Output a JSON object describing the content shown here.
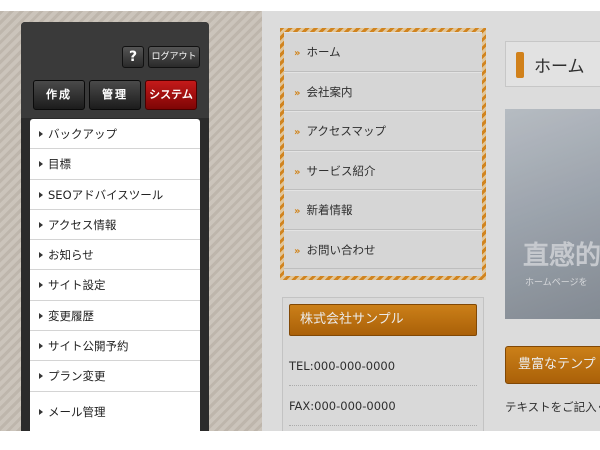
{
  "admin": {
    "help_label": "?",
    "logout_label": "ログアウト",
    "tabs": [
      {
        "label": "作成"
      },
      {
        "label": "管理"
      },
      {
        "label": "システム"
      }
    ],
    "active_tab": "システム",
    "menu": [
      {
        "label": "バックアップ"
      },
      {
        "label": "目標"
      },
      {
        "label": "SEOアドバイスツール"
      },
      {
        "label": "アクセス情報"
      },
      {
        "label": "お知らせ"
      },
      {
        "label": "サイト設定"
      },
      {
        "label": "変更履歴"
      },
      {
        "label": "サイト公開予約"
      },
      {
        "label": "プラン変更"
      },
      {
        "label": "メール管理"
      }
    ],
    "highlighted_item": "メール管理"
  },
  "site": {
    "nav": [
      {
        "label": "ホーム"
      },
      {
        "label": "会社案内"
      },
      {
        "label": "アクセスマップ"
      },
      {
        "label": "サービス紹介"
      },
      {
        "label": "新着情報"
      },
      {
        "label": "お問い合わせ"
      }
    ],
    "nav_marker": "»",
    "company": {
      "name": "株式会社サンプル",
      "tel": "TEL:000-000-0000",
      "fax": "FAX:000-000-0000"
    },
    "home_title": "ホーム",
    "hero_title": "直感的",
    "hero_sub": "ホームページを",
    "template_button": "豊富なテンプ",
    "text_line": "テキストをご記入く"
  },
  "colors": {
    "accent": "#e38c1e",
    "active_tab": "#a40d0d",
    "panel": "#2b2b2b"
  }
}
